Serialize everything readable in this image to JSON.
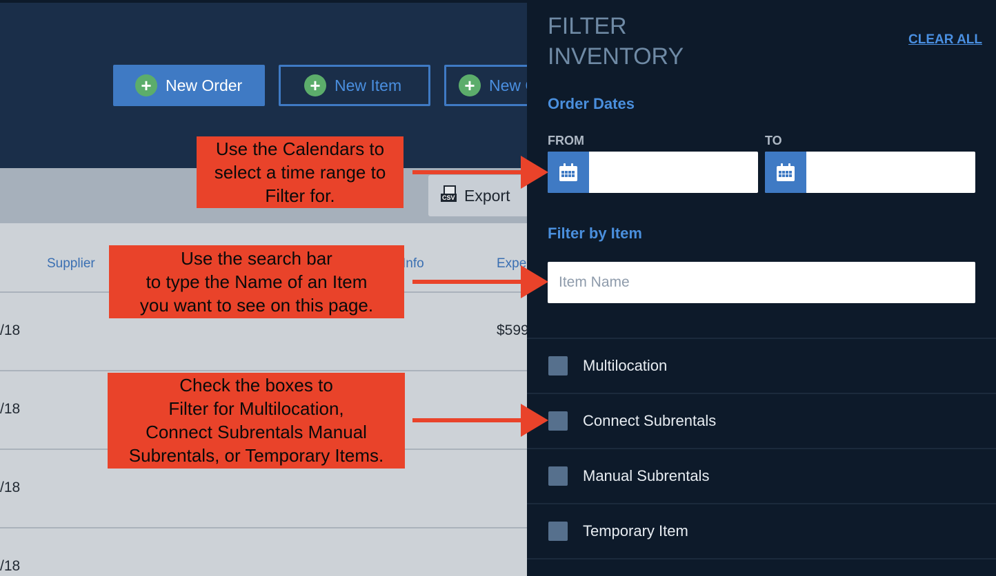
{
  "header": {
    "new_order_label": "New Order",
    "new_item_label": "New Item",
    "third_button_label": "New C",
    "plus_glyph": "+"
  },
  "toolbar": {
    "export_label": "Export",
    "csv_tag": "CSV"
  },
  "table": {
    "columns": [
      "Supplier",
      "Info",
      "Expe"
    ],
    "rows": [
      {
        "date": "/18",
        "amount": "$599"
      },
      {
        "date": "/18",
        "amount": ""
      },
      {
        "date": "/18",
        "amount": ""
      },
      {
        "date": "/18",
        "amount": ""
      }
    ]
  },
  "filter_panel": {
    "title": "FILTER INVENTORY",
    "clear_all_label": "CLEAR ALL",
    "order_dates_title": "Order Dates",
    "from_label": "FROM",
    "to_label": "TO",
    "from_value": "",
    "to_value": "",
    "filter_by_item_title": "Filter by Item",
    "item_name_placeholder": "Item Name",
    "item_name_value": "",
    "checkboxes": [
      {
        "label": "Multilocation",
        "checked": false
      },
      {
        "label": "Connect Subrentals",
        "checked": false
      },
      {
        "label": "Manual Subrentals",
        "checked": false
      },
      {
        "label": "Temporary Item",
        "checked": false
      }
    ]
  },
  "annotations": {
    "calendar_note": "Use the Calendars to\nselect a time range to\nFilter for.",
    "search_note": "Use the search bar\nto type the Name of an Item\nyou want to see on this page.",
    "checkbox_note": "Check the boxes to\nFilter for Multilocation,\nConnect Subrentals Manual\nSubrentals, or Temporary Items."
  },
  "colors": {
    "header_bg": "#1a2e49",
    "panel_bg": "#0d1a2a",
    "accent_blue": "#3f7ac4",
    "plus_green": "#5cad6b",
    "callout_red": "#e9432a",
    "checkbox_fill": "#56708d"
  },
  "icons": {
    "plus": "plus-icon",
    "csv": "csv-file-icon",
    "calendar": "calendar-icon"
  }
}
